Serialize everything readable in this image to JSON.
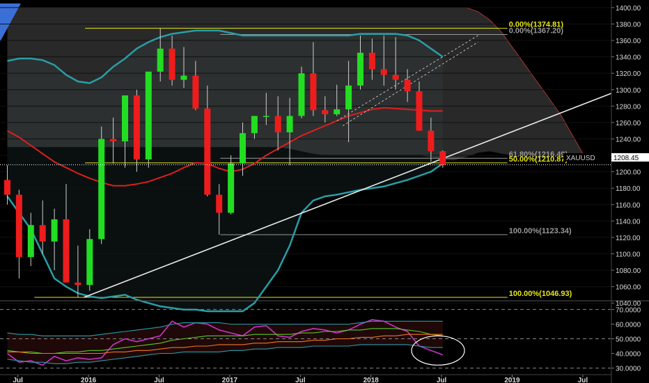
{
  "symbol": "XAUUSD",
  "last_price": "1208.45",
  "colors": {
    "background": "#000000",
    "bull": "#22dd22",
    "bear": "#ee1c1c",
    "bollinger": "#2a9da6",
    "ma": "#dd1f1f",
    "fib_yellow": "#e6e61a",
    "fib_gray": "#9a9a9a",
    "rsi": "#cc33cc",
    "cloud": "#4a4a4a"
  },
  "chart_data": [
    {
      "type": "candlestick",
      "title": "",
      "ylim": [
        1030,
        1405
      ],
      "y_ticks": [
        "1400.00",
        "1380.00",
        "1360.00",
        "1340.00",
        "1320.00",
        "1300.00",
        "1280.00",
        "1260.00",
        "1240.00",
        "1220.00",
        "1200.00",
        "1180.00",
        "1160.00",
        "1140.00",
        "1120.00",
        "1100.00",
        "1080.00",
        "1060.00",
        "1040.00"
      ],
      "y_tick_values": [
        1400,
        1380,
        1360,
        1340,
        1320,
        1300,
        1280,
        1260,
        1240,
        1220,
        1200,
        1180,
        1160,
        1140,
        1120,
        1100,
        1080,
        1060,
        1040
      ],
      "x_ticks": [
        "Jul",
        "2016",
        "Jul",
        "2017",
        "Jul",
        "2018",
        "Jul",
        "2019",
        "Jul"
      ],
      "x_tick_index": [
        0.9,
        6.9,
        12.9,
        18.9,
        24.9,
        30.9,
        36.9,
        42.9,
        48.9
      ],
      "candles": [
        {
          "o": 1190,
          "h": 1208,
          "l": 1160,
          "c": 1172
        },
        {
          "o": 1172,
          "h": 1178,
          "l": 1070,
          "c": 1096
        },
        {
          "o": 1096,
          "h": 1150,
          "l": 1085,
          "c": 1135
        },
        {
          "o": 1135,
          "h": 1165,
          "l": 1100,
          "c": 1115
        },
        {
          "o": 1115,
          "h": 1155,
          "l": 1080,
          "c": 1142
        },
        {
          "o": 1142,
          "h": 1185,
          "l": 1100,
          "c": 1065
        },
        {
          "o": 1065,
          "h": 1110,
          "l": 1046.93,
          "c": 1062
        },
        {
          "o": 1062,
          "h": 1130,
          "l": 1055,
          "c": 1118
        },
        {
          "o": 1118,
          "h": 1255,
          "l": 1112,
          "c": 1240
        },
        {
          "o": 1240,
          "h": 1266,
          "l": 1210,
          "c": 1237
        },
        {
          "o": 1237,
          "h": 1272,
          "l": 1205,
          "c": 1293
        },
        {
          "o": 1293,
          "h": 1300,
          "l": 1200,
          "c": 1215
        },
        {
          "o": 1215,
          "h": 1305,
          "l": 1205,
          "c": 1322
        },
        {
          "o": 1322,
          "h": 1374.81,
          "l": 1310,
          "c": 1350
        },
        {
          "o": 1350,
          "h": 1366,
          "l": 1305,
          "c": 1312
        },
        {
          "o": 1312,
          "h": 1352,
          "l": 1302,
          "c": 1317
        },
        {
          "o": 1317,
          "h": 1335,
          "l": 1275,
          "c": 1277
        },
        {
          "o": 1277,
          "h": 1305,
          "l": 1170,
          "c": 1172
        },
        {
          "o": 1172,
          "h": 1185,
          "l": 1123.34,
          "c": 1150
        },
        {
          "o": 1150,
          "h": 1220,
          "l": 1148,
          "c": 1210
        },
        {
          "o": 1210,
          "h": 1260,
          "l": 1195,
          "c": 1247
        },
        {
          "o": 1247,
          "h": 1268,
          "l": 1240,
          "c": 1268
        },
        {
          "o": 1268,
          "h": 1296,
          "l": 1257,
          "c": 1268
        },
        {
          "o": 1268,
          "h": 1292,
          "l": 1226,
          "c": 1248
        },
        {
          "o": 1248,
          "h": 1290,
          "l": 1208,
          "c": 1268
        },
        {
          "o": 1268,
          "h": 1328,
          "l": 1265,
          "c": 1320
        },
        {
          "o": 1320,
          "h": 1358,
          "l": 1268,
          "c": 1275
        },
        {
          "o": 1275,
          "h": 1292,
          "l": 1260,
          "c": 1270
        },
        {
          "o": 1270,
          "h": 1306,
          "l": 1268,
          "c": 1276
        },
        {
          "o": 1276,
          "h": 1335,
          "l": 1236,
          "c": 1305
        },
        {
          "o": 1305,
          "h": 1366,
          "l": 1300,
          "c": 1345
        },
        {
          "o": 1345,
          "h": 1362,
          "l": 1312,
          "c": 1325
        },
        {
          "o": 1325,
          "h": 1366,
          "l": 1305,
          "c": 1318
        },
        {
          "o": 1318,
          "h": 1364,
          "l": 1300,
          "c": 1312
        },
        {
          "o": 1312,
          "h": 1325,
          "l": 1285,
          "c": 1298
        },
        {
          "o": 1298,
          "h": 1310,
          "l": 1250,
          "c": 1250
        },
        {
          "o": 1250,
          "h": 1266,
          "l": 1212,
          "c": 1225
        },
        {
          "o": 1225,
          "h": 1226,
          "l": 1205,
          "c": 1208.45
        }
      ],
      "ma": [
        1250,
        1242,
        1232,
        1222,
        1212,
        1205,
        1198,
        1192,
        1187,
        1183,
        1183,
        1185,
        1188,
        1193,
        1198,
        1205,
        1211,
        1210,
        1204,
        1200,
        1203,
        1210,
        1220,
        1228,
        1236,
        1244,
        1250,
        1256,
        1262,
        1268,
        1272,
        1276,
        1278,
        1277,
        1276,
        1275,
        1274,
        1274
      ],
      "bb_upper": [
        1335,
        1338,
        1338,
        1336,
        1330,
        1318,
        1310,
        1308,
        1315,
        1328,
        1338,
        1350,
        1358,
        1364,
        1368,
        1370,
        1372,
        1372,
        1372,
        1369,
        1366,
        1366,
        1366,
        1366,
        1366,
        1366,
        1366,
        1366,
        1366,
        1366,
        1368,
        1368,
        1368,
        1368,
        1366,
        1360,
        1350,
        1340
      ],
      "bb_lower": [
        1170,
        1150,
        1130,
        1100,
        1070,
        1060,
        1052,
        1048,
        1046,
        1048,
        1050,
        1044,
        1040,
        1036,
        1034,
        1032,
        1032,
        1030,
        1030,
        1030,
        1030,
        1040,
        1060,
        1080,
        1110,
        1150,
        1165,
        1170,
        1172,
        1175,
        1178,
        1180,
        1182,
        1186,
        1190,
        1195,
        1200,
        1210
      ],
      "cloud_upper": [
        1400,
        1400,
        1400,
        1400,
        1400,
        1400,
        1400,
        1400,
        1400,
        1400,
        1400,
        1400,
        1400,
        1400,
        1400,
        1400,
        1400,
        1400,
        1400,
        1400,
        1400,
        1400,
        1400,
        1400,
        1400,
        1400,
        1400,
        1400,
        1400,
        1400,
        1400,
        1400,
        1400,
        1400,
        1400,
        1400,
        1400,
        1400,
        1400,
        1400,
        1395,
        1385,
        1370,
        1350,
        1330,
        1310,
        1290,
        1270,
        1245,
        1220
      ],
      "cloud_lower": [
        1230,
        1230,
        1230,
        1230,
        1230,
        1230,
        1230,
        1230,
        1230,
        1230,
        1230,
        1230,
        1230,
        1230,
        1230,
        1230,
        1230,
        1230,
        1230,
        1230,
        1230,
        1230,
        1230,
        1230,
        1228,
        1225,
        1222,
        1220,
        1220,
        1220,
        1220,
        1220,
        1220,
        1220,
        1220,
        1220,
        1218,
        1214,
        1214,
        1218,
        1223,
        1225,
        1222,
        1220,
        1220,
        1220,
        1220,
        1220,
        1218,
        1218
      ],
      "fib_levels": [
        {
          "label": "0.00%(1374.81)",
          "value": 1374.81,
          "color": "#e6e61a",
          "x0": 6.6,
          "x1": 42.5
        },
        {
          "label": "0.00%(1367.20)",
          "value": 1367.2,
          "color": "#9a9a9a",
          "x0": 18.1,
          "x1": 42.5
        },
        {
          "label": "61.80%(1216.49)",
          "value": 1216.49,
          "color": "#9a9a9a",
          "x0": 18.1,
          "x1": 42.5
        },
        {
          "label": "50.00%(1210.87)",
          "value": 1210.87,
          "color": "#e6e61a",
          "x0": 6.6,
          "x1": 42.5
        },
        {
          "label": "100.00%(1123.34)",
          "value": 1123.34,
          "color": "#9a9a9a",
          "x0": 18.1,
          "x1": 42.5
        },
        {
          "label": "100.00%(1046.93)",
          "value": 1046.93,
          "color": "#e6e61a",
          "x0": 2.3,
          "x1": 42.5
        }
      ],
      "trendline": {
        "from": {
          "i": 6.5,
          "v": 1046.93
        },
        "to": {
          "i": 57,
          "v": 1327
        }
      },
      "channel_dashed": [
        {
          "from": {
            "i": 28.0,
            "v": 1262
          },
          "to": {
            "i": 40.0,
            "v": 1366
          }
        },
        {
          "from": {
            "i": 28.5,
            "v": 1256
          },
          "to": {
            "i": 40.0,
            "v": 1358
          }
        }
      ]
    },
    {
      "type": "line",
      "title": "",
      "ylim": [
        26,
        74
      ],
      "y_ticks": [
        "70.0000",
        "60.0000",
        "50.0000",
        "40.0000",
        "30.0000"
      ],
      "y_tick_values": [
        70,
        60,
        50,
        40,
        30
      ],
      "dashed_levels": [
        70,
        50,
        30
      ],
      "series": [
        {
          "color": "#cc33cc",
          "values": [
            40,
            34,
            35,
            32,
            38,
            35,
            37,
            36,
            37,
            46,
            50,
            48,
            50,
            52,
            62,
            58,
            61,
            60,
            56,
            54,
            52,
            58,
            59,
            52,
            51,
            55,
            57,
            56,
            54,
            56,
            60,
            63,
            62,
            58,
            55,
            45,
            42,
            39
          ]
        },
        {
          "color": "#55cc22",
          "values": [
            42,
            41,
            41,
            40,
            40,
            41,
            41,
            42,
            42,
            43,
            44,
            45,
            46,
            47,
            49,
            50,
            51,
            52,
            52,
            52,
            52,
            53,
            53,
            53,
            53,
            54,
            54,
            55,
            55,
            56,
            56,
            57,
            57,
            57,
            56,
            55,
            53,
            52
          ]
        },
        {
          "color": "#ee7722",
          "values": [
            41,
            41,
            40,
            40,
            40,
            40,
            40,
            40,
            40,
            41,
            41,
            42,
            42,
            43,
            44,
            44,
            45,
            45,
            46,
            46,
            46,
            47,
            47,
            48,
            48,
            48,
            49,
            49,
            50,
            50,
            51,
            51,
            52,
            52,
            53,
            53,
            53,
            53
          ]
        },
        {
          "color": "#2a9da6",
          "values": [
            36,
            35,
            34,
            34,
            33,
            33,
            34,
            34,
            35,
            36,
            37,
            38,
            39,
            40,
            40,
            41,
            41,
            41,
            41,
            42,
            42,
            43,
            43,
            44,
            44,
            44,
            45,
            45,
            45,
            45,
            46,
            46,
            46,
            46,
            46,
            45,
            44,
            44
          ]
        },
        {
          "color": "#2a9da6",
          "values": [
            54,
            53,
            53,
            52,
            52,
            52,
            52,
            52,
            53,
            54,
            55,
            56,
            57,
            58,
            60,
            61,
            61,
            61,
            61,
            60,
            60,
            60,
            60,
            60,
            60,
            60,
            60,
            60,
            60,
            60,
            61,
            62,
            62,
            62,
            62,
            62,
            62,
            62
          ]
        }
      ],
      "highlight_circle": {
        "i": 36.6,
        "v": 42
      }
    }
  ]
}
